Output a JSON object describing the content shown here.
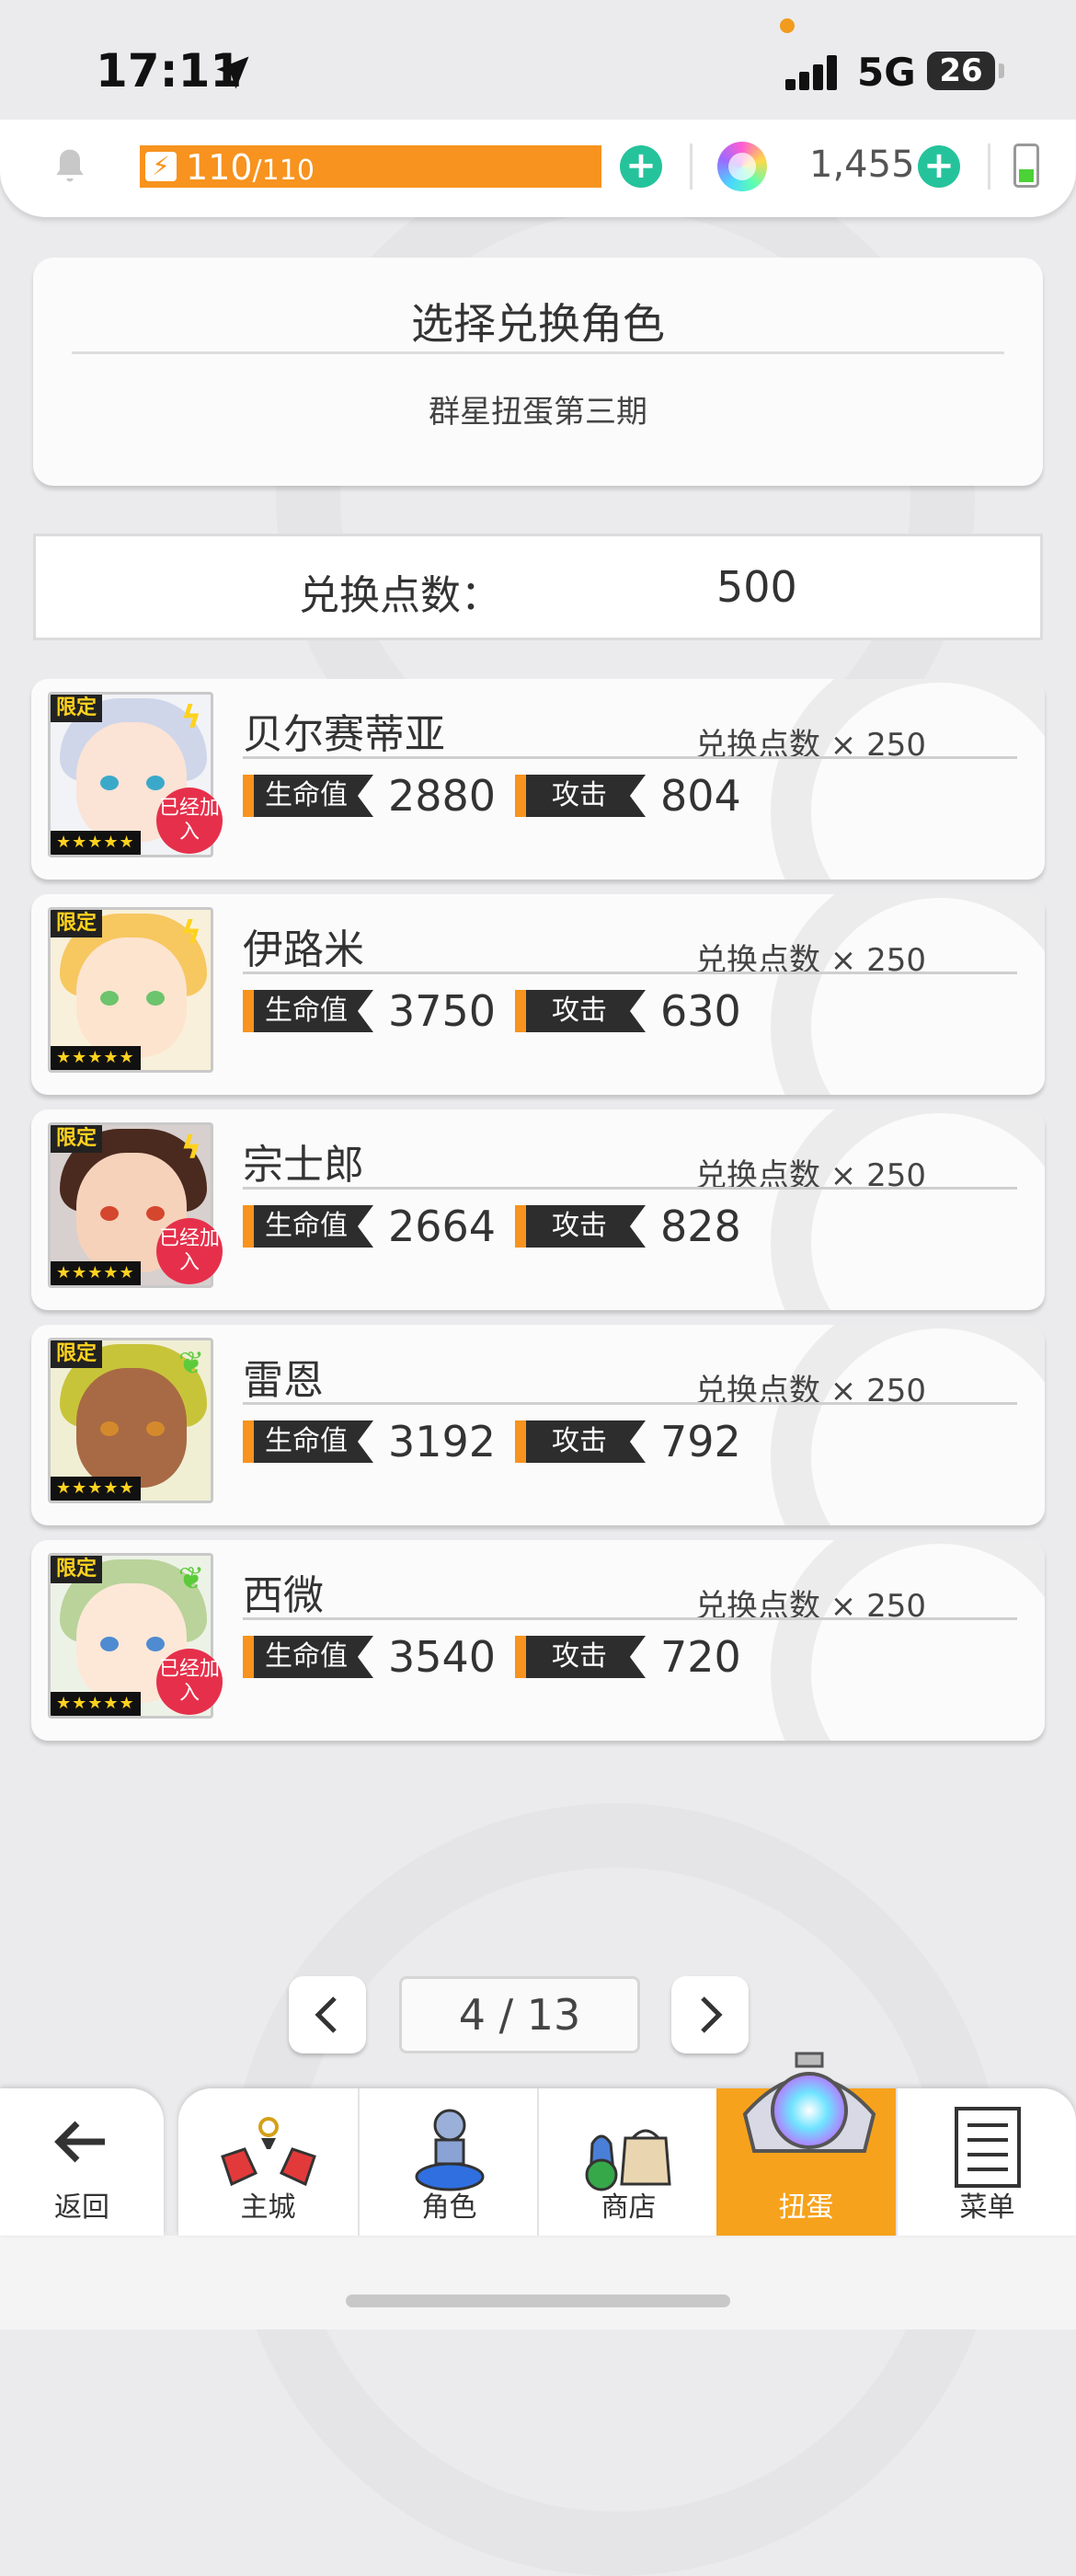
{
  "status_bar": {
    "time": "17:11",
    "network": "5G",
    "battery": "26"
  },
  "resources": {
    "energy_current": "110",
    "energy_max": "/110",
    "gems": "1,455",
    "energy_fill_fraction": 1.0
  },
  "title_card": {
    "title": "选择兑换角色",
    "subtitle": "群星扭蛋第三期"
  },
  "points": {
    "label": "兑换点数：",
    "value": "500"
  },
  "labels": {
    "limited": "限定",
    "hp": "生命值",
    "attack": "攻击",
    "joined": "已经加入",
    "stars": "★★★★★"
  },
  "characters": [
    {
      "name": "贝尔赛蒂亚",
      "cost": "兑换点数 × 250",
      "hp": "2880",
      "attack": "804",
      "element": "lightning-icon",
      "joined": true
    },
    {
      "name": "伊路米",
      "cost": "兑换点数 × 250",
      "hp": "3750",
      "attack": "630",
      "element": "lightning-icon",
      "joined": false
    },
    {
      "name": "宗士郎",
      "cost": "兑换点数 × 250",
      "hp": "2664",
      "attack": "828",
      "element": "lightning-icon",
      "joined": true
    },
    {
      "name": "雷恩",
      "cost": "兑换点数 × 250",
      "hp": "3192",
      "attack": "792",
      "element": "leaf-icon",
      "joined": false
    },
    {
      "name": "西微",
      "cost": "兑换点数 × 250",
      "hp": "3540",
      "attack": "720",
      "element": "leaf-icon",
      "joined": true
    }
  ],
  "pager": {
    "text": "4 / 13"
  },
  "nav": {
    "back": "返回",
    "items": [
      {
        "label": "主城",
        "icon": "castle-icon"
      },
      {
        "label": "角色",
        "icon": "character-icon"
      },
      {
        "label": "商店",
        "icon": "shop-icon"
      },
      {
        "label": "扭蛋",
        "icon": "gacha-icon",
        "active": true
      },
      {
        "label": "菜单",
        "icon": "menu-icon"
      }
    ]
  },
  "colors": {
    "accent": "#f7931e",
    "plus": "#25c39b",
    "joined": "#e6304b",
    "background": "#ebebed"
  }
}
